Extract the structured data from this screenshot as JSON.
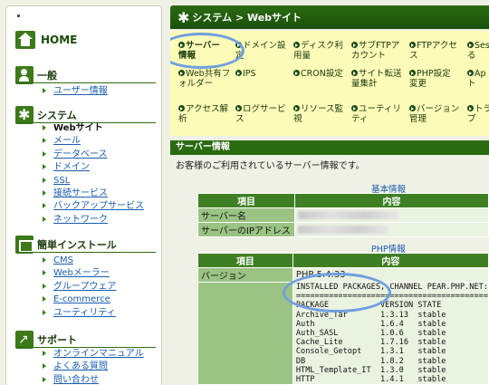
{
  "sidebar": {
    "home": "HOME",
    "sections": [
      {
        "title": "一般",
        "icon": "user-icon",
        "items": [
          "ユーザー情報"
        ]
      },
      {
        "title": "システム",
        "icon": "gear-icon",
        "items": [
          "Webサイト",
          "メール",
          "データベース",
          "ドメイン",
          "SSL",
          "接続サービス",
          "バックアップサービス",
          "ネットワーク"
        ]
      },
      {
        "title": "簡単インストール",
        "icon": "package-icon",
        "items": [
          "CMS",
          "Webメーラー",
          "グループウェア",
          "E-commerce",
          "ユーティリティ"
        ]
      },
      {
        "title": "サポート",
        "icon": "support-icon",
        "items": [
          "オンラインマニュアル",
          "よくある質問",
          "問い合わせ"
        ]
      }
    ]
  },
  "topbar": {
    "breadcrumb": "システム > Webサイト"
  },
  "menu": [
    [
      "サーバー",
      "情報"
    ],
    [
      "ドメイン設",
      "定"
    ],
    [
      "ディスク利",
      "用量"
    ],
    [
      "サブFTPア",
      "カウント"
    ],
    [
      "FTPアクセ",
      "ス"
    ],
    [
      "Ses",
      "る"
    ],
    [
      "Web共有フ",
      "ォルダー"
    ],
    [
      "IPS",
      ""
    ],
    [
      "CRON設定",
      ""
    ],
    [
      "サイト転送",
      "量集計"
    ],
    [
      "PHP設定",
      "変更"
    ],
    [
      "Ap",
      "ト"
    ],
    [
      "アクセス解",
      "析"
    ],
    [
      "ログサービ",
      "ス"
    ],
    [
      "リソース監",
      "視"
    ],
    [
      "ユーティリ",
      "ティ"
    ],
    [
      "バージョン",
      "管理"
    ],
    [
      "トラ",
      "ブ"
    ]
  ],
  "server_info": {
    "heading": "サーバー情報",
    "description": "お客様のご利用されているサーバー情報です。",
    "basic": {
      "title": "基本情報",
      "col_item": "項目",
      "col_content": "内容",
      "rows": [
        "サーバー名",
        "サーバーのIPアドレス"
      ]
    },
    "php": {
      "title": "PHP情報",
      "col_item": "項目",
      "col_content": "内容",
      "version_label": "バージョン",
      "version_value": "PHP 5.4.33",
      "pear_header": "INSTALLED PACKAGES, CHANNEL PEAR.PHP.NET:",
      "pear_rule": "=========================================",
      "pear_cols": "PACKAGE           VERSION STATE",
      "packages": [
        "Archive_Tar       1.3.13  stable",
        "Auth              1.6.4   stable",
        "Auth_SASL         1.0.6   stable",
        "Cache_Lite        1.7.16  stable",
        "Console_Getopt    1.3.1   stable",
        "DB                1.8.2   stable",
        "HTML_Template_IT  1.3.0   stable",
        "HTTP              1.4.1   stable"
      ]
    }
  },
  "colors": {
    "accent_green": "#2a6b12",
    "menu_bg": "#fdfbb8",
    "highlight": "#6f9fe0",
    "link": "#1a5cb0"
  }
}
